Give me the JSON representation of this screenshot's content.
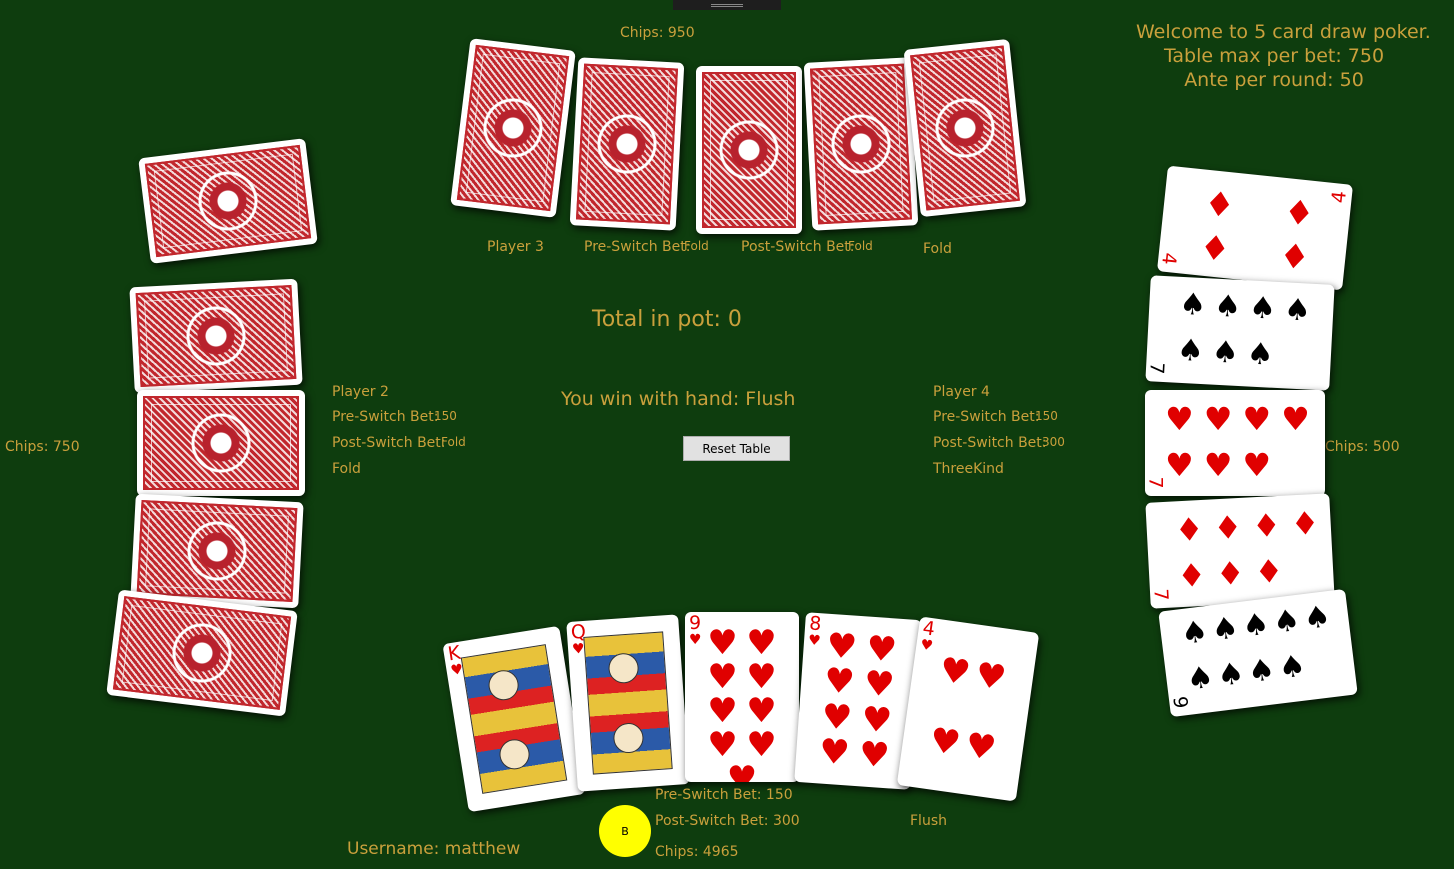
{
  "welcome": {
    "line1": "Welcome to 5 card draw poker.",
    "line2": "Table max per bet: 750",
    "line3": "Ante per round: 50"
  },
  "pot": {
    "text": "Total in pot: 0"
  },
  "result": {
    "text": "You win with hand: Flush"
  },
  "reset_button": {
    "label": "Reset Table"
  },
  "player3": {
    "chips": "Chips: 950",
    "name": "Player 3",
    "pre_label": "Pre-Switch Bet:",
    "pre_value": "Fold",
    "post_label": "Post-Switch Bet:",
    "post_value": "Fold",
    "hand": "Fold"
  },
  "player2": {
    "chips": "Chips: 750",
    "name": "Player 2",
    "pre_label": "Pre-Switch Bet:",
    "pre_value": "150",
    "post_label": "Post-Switch Bet:",
    "post_value": "Fold",
    "hand": "Fold"
  },
  "player4": {
    "chips": "Chips: 500",
    "name": "Player 4",
    "pre_label": "Pre-Switch Bet:",
    "pre_value": "150",
    "post_label": "Post-Switch Bet:",
    "post_value": "300",
    "hand": "ThreeKind",
    "cards": [
      {
        "rank": "4",
        "suit": "♦",
        "color": "red"
      },
      {
        "rank": "7",
        "suit": "♠",
        "color": "black"
      },
      {
        "rank": "7",
        "suit": "♥",
        "color": "red"
      },
      {
        "rank": "7",
        "suit": "♦",
        "color": "red"
      },
      {
        "rank": "9",
        "suit": "♠",
        "color": "black"
      }
    ]
  },
  "player1": {
    "username": "Username: matthew",
    "pre": "Pre-Switch Bet: 150",
    "post": "Post-Switch Bet: 300",
    "chips": "Chips: 4965",
    "hand": "Flush",
    "dealer_button": "B",
    "cards": [
      {
        "rank": "K",
        "suit": "♥",
        "color": "red"
      },
      {
        "rank": "Q",
        "suit": "♥",
        "color": "red"
      },
      {
        "rank": "9",
        "suit": "♥",
        "color": "red"
      },
      {
        "rank": "8",
        "suit": "♥",
        "color": "red"
      },
      {
        "rank": "4",
        "suit": "♥",
        "color": "red"
      }
    ]
  },
  "colors": {
    "table": "#0e3d0e",
    "text": "#c9a03c",
    "card_back": "#c1272d",
    "dealer_chip": "#ffff00"
  }
}
